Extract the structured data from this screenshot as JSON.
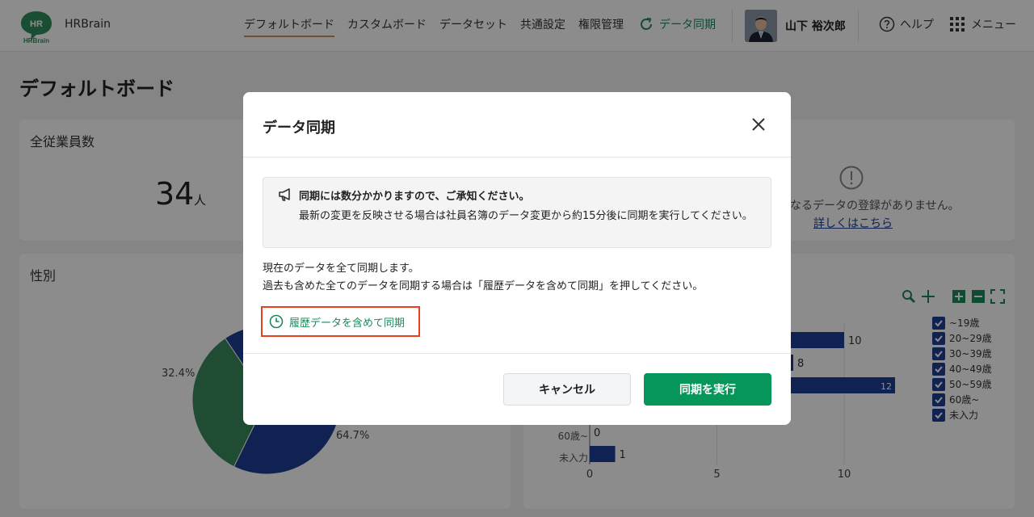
{
  "header": {
    "brand": "HRBrain",
    "logo_text_top": "HR",
    "logo_text_bottom": "HRBrain",
    "nav": [
      {
        "label": "デフォルトボード",
        "active": true
      },
      {
        "label": "カスタムボード",
        "active": false
      },
      {
        "label": "データセット",
        "active": false
      },
      {
        "label": "共通設定",
        "active": false
      },
      {
        "label": "権限管理",
        "active": false
      }
    ],
    "sync_label": "データ同期",
    "user_name": "山下 裕次郎",
    "help_label": "ヘルプ",
    "menu_label": "メニュー"
  },
  "page": {
    "title": "デフォルトボード",
    "employee_card": {
      "title": "全従業員数",
      "value": "34",
      "unit": "人"
    },
    "empty_card": {
      "message": "なるデータの登録がありません。",
      "link": "詳しくはこちら"
    },
    "gender_card": {
      "title": "性別"
    }
  },
  "pie_chart": {
    "type": "pie",
    "slices": [
      {
        "label": "32.4%",
        "value": 32.4,
        "color": "#3a8a5e"
      },
      {
        "label": "64.7%",
        "value": 64.7,
        "color": "#1e3f95"
      }
    ]
  },
  "chart_data": {
    "type": "bar",
    "orientation": "horizontal",
    "categories": [
      "~19歳",
      "20~29歳",
      "30~39歳",
      "40~49歳",
      "50~59歳",
      "60歳~",
      "未入力"
    ],
    "values": [
      10,
      8,
      12,
      null,
      null,
      0,
      1
    ],
    "visible_category_labels": [
      "60歳~",
      "未入力"
    ],
    "x_ticks": [
      "0",
      "5",
      "10"
    ],
    "xlim": [
      0,
      12
    ],
    "legend": [
      "~19歳",
      "20~29歳",
      "30~39歳",
      "40~49歳",
      "50~59歳",
      "60歳~",
      "未入力"
    ],
    "legend_placement": "right",
    "bar_color": "#1e3f95"
  },
  "modal": {
    "title": "データ同期",
    "notice_title": "同期には数分かかりますので、ご承知ください。",
    "notice_body": "最新の変更を反映させる場合は社員名簿のデータ変更から約15分後に同期を実行してください。",
    "desc_line1": "現在のデータを全て同期します。",
    "desc_line2": "過去も含めた全てのデータを同期する場合は「履歴データを含めて同期」を押してください。",
    "history_button": "履歴データを含めて同期",
    "cancel_button": "キャンセル",
    "execute_button": "同期を実行"
  }
}
